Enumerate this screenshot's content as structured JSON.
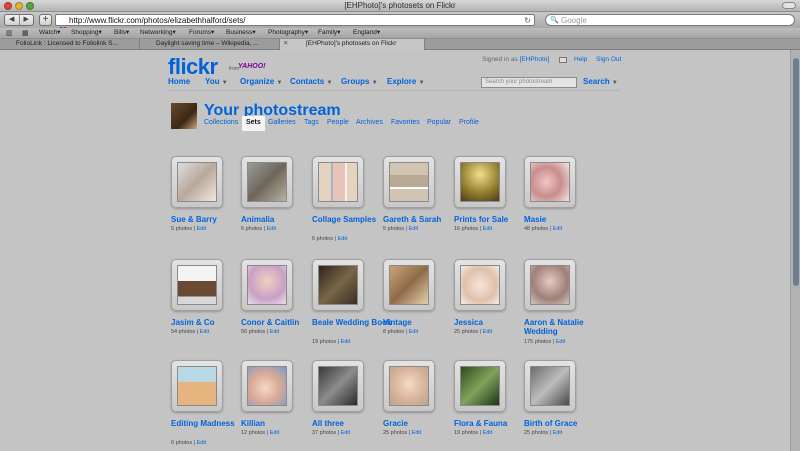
{
  "window": {
    "title": "[EHPhoto]'s photosets on Flickr"
  },
  "toolbar": {
    "back": "◀",
    "forward": "▶",
    "add": "+",
    "url": "http://www.flickr.com/photos/elizabethhalford/sets/",
    "search_placeholder": "Google"
  },
  "bookmarks": [
    "Watch▾",
    "Shopping▾",
    "Bills▾",
    "Networking▾",
    "Forums▾",
    "Business▾",
    "Photography▾",
    "Family▾",
    "England▾"
  ],
  "tabs": [
    "FolioLink : Licensed to Foliolink S...",
    "Daylight saving time – Wikipedia, ...",
    "[EHPhoto]'s photosets on Flickr"
  ],
  "header": {
    "logo": "flickr",
    "logo_from": "from",
    "logo_yahoo": "YAHOO!",
    "signed_in": "Signed in as",
    "username": "[EHPhoto]",
    "help": "Help",
    "sign_out": "Sign Out",
    "nav": [
      "Home",
      "You",
      "Organize",
      "Contacts",
      "Groups",
      "Explore"
    ],
    "search_placeholder": "Search your photostream",
    "search": "Search"
  },
  "photostream": {
    "title": "Your photostream",
    "subnav": [
      "Collections",
      "Sets",
      "Galleries",
      "Tags",
      "People",
      "Archives",
      "Favorites",
      "Popular",
      "Profile"
    ],
    "active": "Sets"
  },
  "sets": [
    {
      "title": "Sue & Barry",
      "count": "5 photos",
      "edit": "Edit"
    },
    {
      "title": "Animalia",
      "count": "6 photos",
      "edit": "Edit"
    },
    {
      "title": "Collage Samples",
      "count": "6 photos",
      "edit": "Edit"
    },
    {
      "title": "Gareth & Sarah",
      "count": "5 photos",
      "edit": "Edit"
    },
    {
      "title": "Prints for Sale",
      "count": "16 photos",
      "edit": "Edit"
    },
    {
      "title": "Masie",
      "count": "48 photos",
      "edit": "Edit"
    },
    {
      "title": "Jasim & Co",
      "count": "54 photos",
      "edit": "Edit"
    },
    {
      "title": "Conor & Caitlin",
      "count": "56 photos",
      "edit": "Edit"
    },
    {
      "title": "Beale Wedding Book",
      "count": "19 photos",
      "edit": "Edit"
    },
    {
      "title": "Vintage",
      "count": "8 photos",
      "edit": "Edit"
    },
    {
      "title": "Jessica",
      "count": "25 photos",
      "edit": "Edit"
    },
    {
      "title": "Aaron & Natalie Wedding",
      "count": "175 photos",
      "edit": "Edit"
    },
    {
      "title": "Editing Madness",
      "count": "6 photos",
      "edit": "Edit"
    },
    {
      "title": "Killian",
      "count": "12 photos",
      "edit": "Edit"
    },
    {
      "title": "All three",
      "count": "37 photos",
      "edit": "Edit"
    },
    {
      "title": "Gracie",
      "count": "25 photos",
      "edit": "Edit"
    },
    {
      "title": "Flora & Fauna",
      "count": "19 photos",
      "edit": "Edit"
    },
    {
      "title": "Birth of Grace",
      "count": "25 photos",
      "edit": "Edit"
    }
  ]
}
